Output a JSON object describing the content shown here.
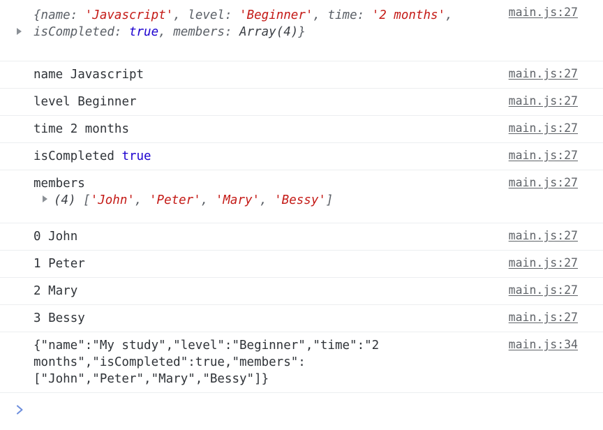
{
  "console": {
    "source_link_default": "main.js:27",
    "colors": {
      "string": "#c41a16",
      "boolean": "#1c00cf",
      "text": "#2f3338",
      "muted": "#5a5f66",
      "link": "#5f6368",
      "prompt": "#6e8fdd",
      "separator": "#eceef0",
      "background": "#ffffff"
    },
    "entries": [
      {
        "kind": "object-preview",
        "expanded": false,
        "text_line1": "{name: 'Javascript', level: 'Beginner', time: '2 months',",
        "text_line2": "isCompleted: true, members: Array(4)}",
        "parts": {
          "open_brace": "{",
          "k_name": "name: ",
          "v_name": "'Javascript'",
          "sep1": ", ",
          "k_level": "level: ",
          "v_level": "'Beginner'",
          "sep2": ", ",
          "k_time": "time: ",
          "v_time": "'2 months'",
          "sep3": ",",
          "k_isCompleted": "isCompleted: ",
          "v_isCompleted": "true",
          "sep4": ", ",
          "k_members": "members: ",
          "v_members": "Array(4)",
          "close_brace": "}"
        },
        "source": "main.js:27"
      },
      {
        "kind": "kv",
        "key": "name",
        "value": "Javascript",
        "value_type": "string",
        "source": "main.js:27"
      },
      {
        "kind": "kv",
        "key": "level",
        "value": "Beginner",
        "value_type": "string",
        "source": "main.js:27"
      },
      {
        "kind": "kv",
        "key": "time",
        "value": "2 months",
        "value_type": "string",
        "source": "main.js:27"
      },
      {
        "kind": "kv",
        "key": "isCompleted",
        "value": "true",
        "value_type": "boolean",
        "source": "main.js:27"
      },
      {
        "kind": "array-preview",
        "expanded": false,
        "label": "members",
        "count_prefix": "(4)",
        "items_text": "['John', 'Peter', 'Mary', 'Bessy']",
        "parts": {
          "open": "[",
          "i0": "'John'",
          "c0": ", ",
          "i1": "'Peter'",
          "c1": ", ",
          "i2": "'Mary'",
          "c2": ", ",
          "i3": "'Bessy'",
          "close": "]"
        },
        "source": "main.js:27"
      },
      {
        "kind": "kv",
        "key": "0",
        "value": "John",
        "value_type": "string",
        "source": "main.js:27"
      },
      {
        "kind": "kv",
        "key": "1",
        "value": "Peter",
        "value_type": "string",
        "source": "main.js:27"
      },
      {
        "kind": "kv",
        "key": "2",
        "value": "Mary",
        "value_type": "string",
        "source": "main.js:27"
      },
      {
        "kind": "kv",
        "key": "3",
        "value": "Bessy",
        "value_type": "string",
        "source": "main.js:27"
      },
      {
        "kind": "json-string",
        "text": "{\"name\":\"My study\",\"level\":\"Beginner\",\"time\":\"2 months\",\"isCompleted\":true,\"members\":[\"John\",\"Peter\",\"Mary\",\"Bessy\"]}",
        "source": "main.js:34"
      }
    ],
    "prompt": {
      "chevron": "chevron-right-icon",
      "value": "",
      "placeholder": ""
    }
  }
}
